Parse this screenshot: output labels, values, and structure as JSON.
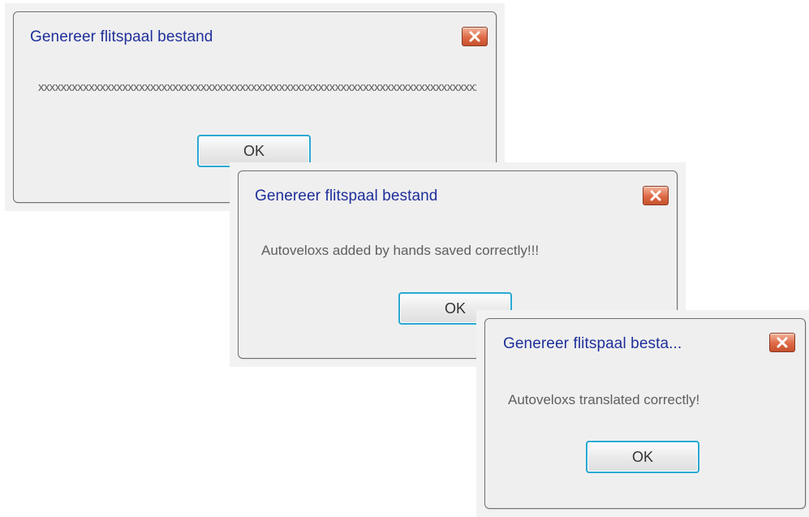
{
  "dialogs": [
    {
      "title": "Genereer flitspaal bestand",
      "message": "xxxxxxxxxxxxxxxxxxxxxxxxxxxxxxxxxxxxxxxxxxxxxxxxxxxxxxxxxxxxxxxxxxxxxxxxxxxxxxxxxxxxxxxxxxx",
      "ok_label": "OK"
    },
    {
      "title": "Genereer flitspaal bestand",
      "message": "Autoveloxs added by hands saved correctly!!!",
      "ok_label": "OK"
    },
    {
      "title": "Genereer flitspaal besta...",
      "message": "Autoveloxs translated correctly!",
      "ok_label": "OK"
    }
  ],
  "colors": {
    "title_text": "#1f2f9a",
    "ok_border": "#28a9d3",
    "close_button": "#de6a45"
  },
  "icons": {
    "close": "close-x-icon"
  }
}
